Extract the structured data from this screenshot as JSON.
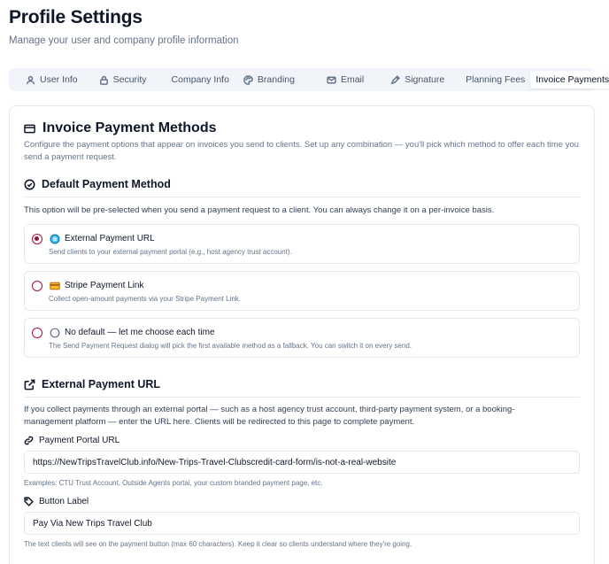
{
  "header": {
    "title": "Profile Settings",
    "subtitle": "Manage your user and company profile information"
  },
  "tabs": [
    {
      "label": "User Info",
      "icon": "user-icon"
    },
    {
      "label": "Security",
      "icon": "lock-icon"
    },
    {
      "label": "Company Info",
      "icon": ""
    },
    {
      "label": "Branding",
      "icon": "palette-icon"
    },
    {
      "label": "Email",
      "icon": "mail-icon"
    },
    {
      "label": "Signature",
      "icon": "pen-tool-icon"
    },
    {
      "label": "Planning Fees",
      "icon": ""
    },
    {
      "label": "Invoice Payments",
      "icon": "",
      "active": true
    }
  ],
  "card": {
    "title": "Invoice Payment Methods",
    "description": "Configure the payment options that appear on invoices you send to clients. Set up any combination — you'll pick which method to offer each time you send a payment request."
  },
  "default_method": {
    "heading": "Default Payment Method",
    "description": "This option will be pre-selected when you send a payment request to a client. You can always change it on a per-invoice basis.",
    "options": [
      {
        "label": "External Payment URL",
        "description": "Send clients to your external payment portal (e.g., host agency trust account).",
        "checked": true,
        "icon": "globe-icon"
      },
      {
        "label": "Stripe Payment Link",
        "description": "Collect open-amount payments via your Stripe Payment Link.",
        "checked": false,
        "icon": "credit-card-icon"
      },
      {
        "label": "No default — let me choose each time",
        "description": "The Send Payment Request dialog will pick the first available method as a fallback. You can switch it on every send.",
        "checked": false,
        "icon": "circle-icon"
      }
    ]
  },
  "external_url": {
    "heading": "External Payment URL",
    "description": "If you collect payments through an external portal — such as a host agency trust account, third-party payment system, or a booking-management platform — enter the URL here. Clients will be redirected to this page to complete payment.",
    "portal_label": "Payment Portal URL",
    "portal_value": "https://NewTripsTravelClub.info/New-Trips-Travel-Clubscredit-card-form/is-not-a-real-website",
    "portal_hint": "Examples: CTU Trust Account, Outside Agents portal, your custom branded payment page, etc.",
    "button_label": "Button Label",
    "button_value": "Pay Via New Trips Travel Club",
    "button_hint": "The text clients will see on the payment button (max 60 characters). Keep it clear so clients understand where they're going."
  },
  "colors": {
    "accent": "#9f1239",
    "border": "#e2e8f0",
    "muted_text": "#64748b"
  }
}
